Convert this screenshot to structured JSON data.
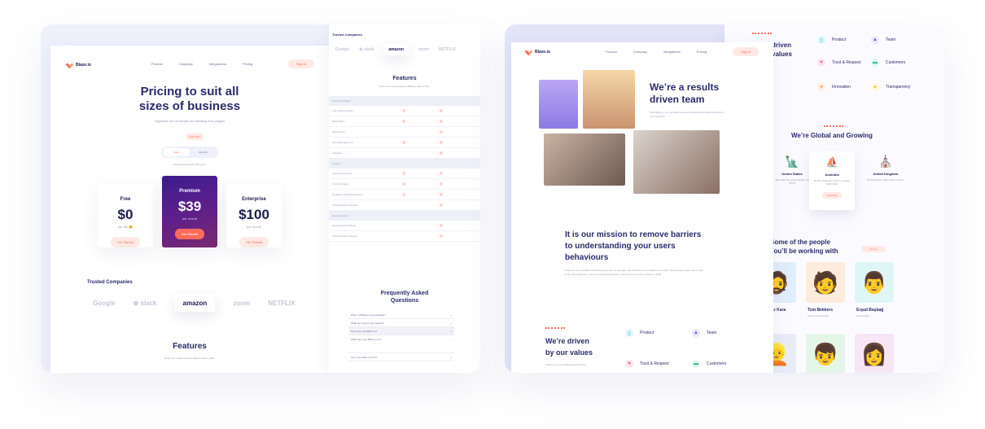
{
  "left": {
    "logo": "Blaze.io",
    "nav": [
      "Product",
      "Company",
      "Integrations",
      "Pricing"
    ],
    "signin": "Sign in",
    "hero_title_1": "Pricing to suit all",
    "hero_title_2": "sizes of business",
    "hero_sub": "Upgrades are as simple as installing new plugins",
    "save_badge": "Save 20%",
    "toggle": [
      "Yearly",
      "Monthly"
    ],
    "toggle_note": "Yearly and get 20% off coupon",
    "plans": [
      {
        "name": "Free",
        "price": "$0",
        "per": "per life 😊",
        "cta": "Get Started"
      },
      {
        "name": "Premium",
        "price": "$39",
        "per": "per month",
        "cta": "Get Started"
      },
      {
        "name": "Enterprise",
        "price": "$100",
        "per": "per month",
        "cta": "Get Started"
      }
    ],
    "trusted_title": "Trusted Companies",
    "logos": [
      "Google",
      "⊛ slack",
      "amazon",
      "zoom",
      "NETFLIX"
    ],
    "features_title": "Features",
    "features_sub": "Enjoy the unique features Blaze.io has to offer"
  },
  "middle": {
    "trusted_title": "Trusted Companies",
    "logos": [
      "Google",
      "⊛ slack",
      "amazon",
      "zoom",
      "NETFLIX"
    ],
    "features_title": "Features",
    "features_sub": "Enjoy the unique features Blaze.io has to offer",
    "section_a": "Feature Included",
    "rows_a": [
      "Full Landing Pages",
      "Blog Tables",
      "Integrations",
      "Team Management",
      "Analytics"
    ],
    "section_b": "Support",
    "rows_b": [
      "Free Development",
      "Priority Support",
      "Dedicated Technical Support",
      "Chat Dedicated Support"
    ],
    "section_c": "Team Features",
    "rows_c": [
      "Email Support Tickets",
      "Chat Dedicated Support"
    ],
    "faq_title_1": "Frequently Asked",
    "faq_title_2": "Questions",
    "faq": [
      "When will Blaze.io be available?",
      "What do I need to get started?",
      "How can I use Blaze.io?",
      "What can I use Blaze.io for?",
      "Can I purchase one Kit?"
    ]
  },
  "right": {
    "logo": "Blaze.io",
    "nav": [
      "Product",
      "Company",
      "Integrations",
      "Pricing"
    ],
    "signin": "Sign in",
    "hero_title_1": "We’re a results",
    "hero_title_2": "driven team",
    "hero_sub": "With Blaze.io you can build a powerful website and drive success for your business.",
    "mission_1": "It is our mission to remove barriers",
    "mission_2": "to understanding your users",
    "mission_3": "behaviours",
    "mission_body": "Culture is an incredibly important part of how we operate. We stand by six key pillars to success. These ensure we're all moving in the same direction, and encourage the inclusive, diverse business we continue to build.",
    "driven_1": "We’re driven",
    "driven_2": "by our values",
    "driven_body": "Culture is an incredibly important part",
    "values": [
      "Product",
      "Team",
      "Trust & Respect",
      "Customers"
    ]
  },
  "far_right": {
    "heading_1": "driven",
    "heading_2": "values",
    "values": [
      "Product",
      "Team",
      "Trust & Respect",
      "Customers",
      "Innovation",
      "Transparency"
    ],
    "global_title": "We’re Global and Growing",
    "offices": [
      {
        "name": "United States",
        "addr": "4111 3RD Boulevard Austin, TX 78701"
      },
      {
        "name": "Australia",
        "addr": "45 503 Melbourne Street, Sydney NSW 2000"
      },
      {
        "name": "United Kingdom",
        "addr": "88 Shoreditch High Street London"
      }
    ],
    "view_map": "View Map",
    "people_title_1": "Some of the people",
    "people_title_2": "you’ll be working with",
    "people_btn": "Join us",
    "people": [
      {
        "name": "Yağız Kara",
        "role": ""
      },
      {
        "name": "Tom Bekkers",
        "role": "CTO & Co-Founder"
      },
      {
        "name": "Erşad Başbağ",
        "role": "Co-Founder"
      }
    ]
  }
}
